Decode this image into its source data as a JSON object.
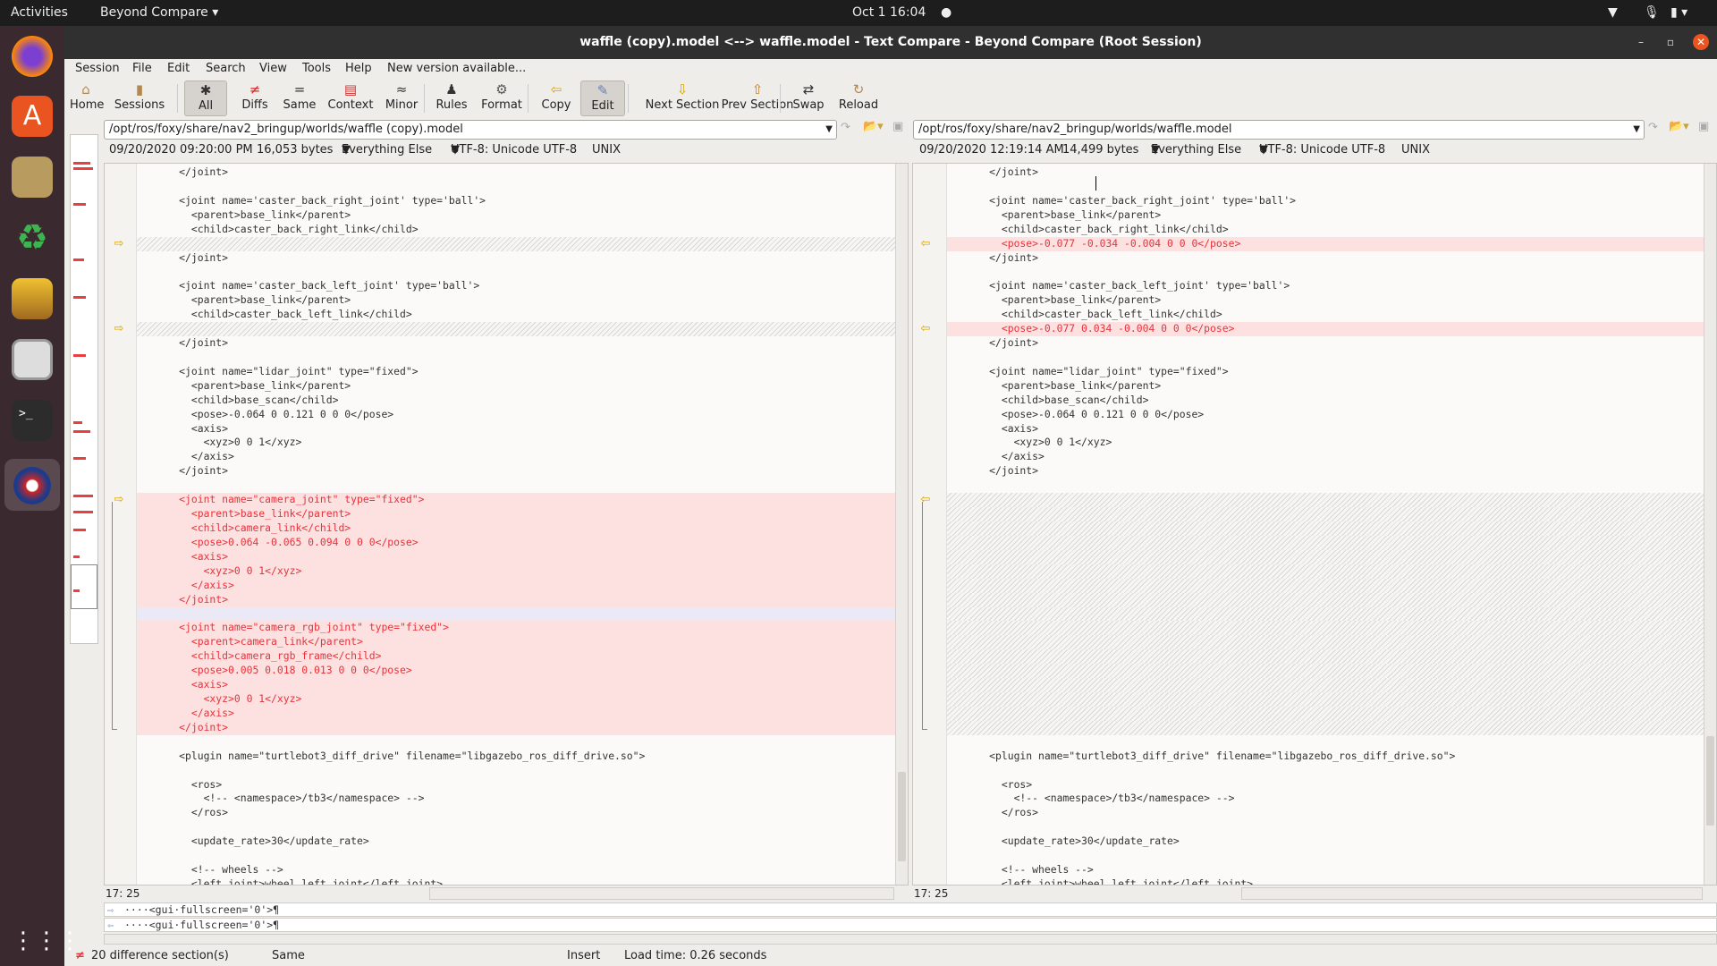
{
  "topbar": {
    "activities": "Activities",
    "app": "Beyond Compare",
    "clock": "Oct 1  16:04"
  },
  "dock": {
    "apps": [
      "firefox-icon",
      "software-center-icon",
      "installer-icon",
      "sync-icon",
      "cleaner-icon",
      "files-icon",
      "terminal-icon",
      "beyond-compare-icon"
    ],
    "grid": "app-grid-icon"
  },
  "window": {
    "title": "waffle (copy).model <--> waffle.model - Text Compare - Beyond Compare (Root Session)"
  },
  "menu": [
    "Session",
    "File",
    "Edit",
    "Search",
    "View",
    "Tools",
    "Help",
    "New version available..."
  ],
  "toolbar": [
    {
      "label": "Home",
      "icon": "⌂"
    },
    {
      "label": "Sessions",
      "icon": "▮"
    },
    {
      "label": "All",
      "icon": "✱",
      "active": true
    },
    {
      "label": "Diffs",
      "icon": "≠"
    },
    {
      "label": "Same",
      "icon": "="
    },
    {
      "label": "Context",
      "icon": "▤"
    },
    {
      "label": "Minor",
      "icon": "≈"
    },
    {
      "label": "Rules",
      "icon": "♟"
    },
    {
      "label": "Format",
      "icon": "⚙"
    },
    {
      "label": "Copy",
      "icon": "⇦"
    },
    {
      "label": "Edit",
      "icon": "✎",
      "active": true
    },
    {
      "label": "Next Section",
      "icon": "⇩"
    },
    {
      "label": "Prev Section",
      "icon": "⇧"
    },
    {
      "label": "Swap",
      "icon": "⇄"
    },
    {
      "label": "Reload",
      "icon": "↻"
    }
  ],
  "left": {
    "path": "/opt/ros/foxy/share/nav2_bringup/worlds/waffle (copy).model",
    "date": "09/20/2020 09:20:00 PM",
    "size": "16,053 bytes",
    "format": "Everything Else",
    "encoding": "UTF-8: Unicode UTF-8",
    "lineend": "UNIX",
    "position": "17: 25"
  },
  "right": {
    "path": "/opt/ros/foxy/share/nav2_bringup/worlds/waffle.model",
    "date": "09/20/2020 12:19:14 AM",
    "size": "14,499 bytes",
    "format": "Everything Else",
    "encoding": "UTF-8: Unicode UTF-8",
    "lineend": "UNIX",
    "position": "17: 25"
  },
  "rows": [
    {
      "l": "      </joint>",
      "r": "      </joint>"
    },
    {
      "l": "",
      "r": ""
    },
    {
      "l": "      <joint name='caster_back_right_joint' type='ball'>",
      "r": "      <joint name='caster_back_right_joint' type='ball'>"
    },
    {
      "l": "        <parent>base_link</parent>",
      "r": "        <parent>base_link</parent>"
    },
    {
      "l": "        <child>caster_back_right_link</child>",
      "r": "        <child>caster_back_right_link</child>"
    },
    {
      "l": null,
      "r": "        <pose>-0.077 -0.034 -0.004 0 0 0</pose>",
      "t": "right"
    },
    {
      "l": "      </joint>",
      "r": "      </joint>"
    },
    {
      "l": "",
      "r": ""
    },
    {
      "l": "      <joint name='caster_back_left_joint' type='ball'>",
      "r": "      <joint name='caster_back_left_joint' type='ball'>"
    },
    {
      "l": "        <parent>base_link</parent>",
      "r": "        <parent>base_link</parent>"
    },
    {
      "l": "        <child>caster_back_left_link</child>",
      "r": "        <child>caster_back_left_link</child>"
    },
    {
      "l": null,
      "r": "        <pose>-0.077 0.034 -0.004 0 0 0</pose>",
      "t": "right"
    },
    {
      "l": "      </joint>",
      "r": "      </joint>"
    },
    {
      "l": "",
      "r": ""
    },
    {
      "l": "      <joint name=\"lidar_joint\" type=\"fixed\">",
      "r": "      <joint name=\"lidar_joint\" type=\"fixed\">"
    },
    {
      "l": "        <parent>base_link</parent>",
      "r": "        <parent>base_link</parent>"
    },
    {
      "l": "        <child>base_scan</child>",
      "r": "        <child>base_scan</child>"
    },
    {
      "l": "        <pose>-0.064 0 0.121 0 0 0</pose>",
      "r": "        <pose>-0.064 0 0.121 0 0 0</pose>"
    },
    {
      "l": "        <axis>",
      "r": "        <axis>"
    },
    {
      "l": "          <xyz>0 0 1</xyz>",
      "r": "          <xyz>0 0 1</xyz>"
    },
    {
      "l": "        </axis>",
      "r": "        </axis>"
    },
    {
      "l": "      </joint>",
      "r": "      </joint>"
    },
    {
      "l": "",
      "r": ""
    },
    {
      "l": "      <joint name=\"camera_joint\" type=\"fixed\">",
      "r": null,
      "t": "left"
    },
    {
      "l": "        <parent>base_link</parent>",
      "r": null,
      "t": "left"
    },
    {
      "l": "        <child>camera_link</child>",
      "r": null,
      "t": "left"
    },
    {
      "l": "        <pose>0.064 -0.065 0.094 0 0 0</pose>",
      "r": null,
      "t": "left"
    },
    {
      "l": "        <axis>",
      "r": null,
      "t": "left"
    },
    {
      "l": "          <xyz>0 0 1</xyz>",
      "r": null,
      "t": "left"
    },
    {
      "l": "        </axis>",
      "r": null,
      "t": "left"
    },
    {
      "l": "      </joint>",
      "r": null,
      "t": "left"
    },
    {
      "l": "",
      "r": null,
      "t": "cur"
    },
    {
      "l": "      <joint name=\"camera_rgb_joint\" type=\"fixed\">",
      "r": null,
      "t": "left"
    },
    {
      "l": "        <parent>camera_link</parent>",
      "r": null,
      "t": "left"
    },
    {
      "l": "        <child>camera_rgb_frame</child>",
      "r": null,
      "t": "left"
    },
    {
      "l": "        <pose>0.005 0.018 0.013 0 0 0</pose>",
      "r": null,
      "t": "left"
    },
    {
      "l": "        <axis>",
      "r": null,
      "t": "left"
    },
    {
      "l": "          <xyz>0 0 1</xyz>",
      "r": null,
      "t": "left"
    },
    {
      "l": "        </axis>",
      "r": null,
      "t": "left"
    },
    {
      "l": "      </joint>",
      "r": null,
      "t": "left"
    },
    {
      "l": "",
      "r": ""
    },
    {
      "l": "      <plugin name=\"turtlebot3_diff_drive\" filename=\"libgazebo_ros_diff_drive.so\">",
      "r": "      <plugin name=\"turtlebot3_diff_drive\" filename=\"libgazebo_ros_diff_drive.so\">"
    },
    {
      "l": "",
      "r": ""
    },
    {
      "l": "        <ros>",
      "r": "        <ros>"
    },
    {
      "l": "          <!-- <namespace>/tb3</namespace> -->",
      "r": "          <!-- <namespace>/tb3</namespace> -->"
    },
    {
      "l": "        </ros>",
      "r": "        </ros>"
    },
    {
      "l": "",
      "r": ""
    },
    {
      "l": "        <update_rate>30</update_rate>",
      "r": "        <update_rate>30</update_rate>"
    },
    {
      "l": "",
      "r": ""
    },
    {
      "l": "        <!-- wheels -->",
      "r": "        <!-- wheels -->"
    },
    {
      "l": "        <left_joint>wheel_left_joint</left_joint>",
      "r": "        <left_joint>wheel_left_joint</left_joint>"
    }
  ],
  "diff_arrows": [
    5,
    11,
    23
  ],
  "detail": {
    "left": "····<gui·fullscreen='0'>¶",
    "right": "····<gui·fullscreen='0'>¶"
  },
  "status": {
    "diffs": "20 difference section(s)",
    "same": "Same",
    "mode": "Insert",
    "load": "Load time: 0.26 seconds"
  },
  "colors": {
    "diff_bg": "#fde1e1",
    "diff_text": "#e8323a",
    "arrow": "#d9a400"
  }
}
